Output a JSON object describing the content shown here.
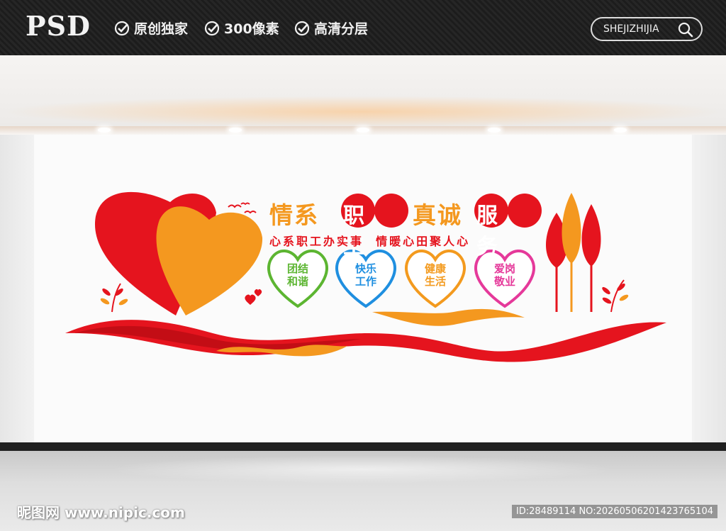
{
  "header": {
    "brand": "PSD",
    "features": [
      "原创独家",
      "300像素",
      "高清分层"
    ],
    "search_label": "SHEJIZHIJIA"
  },
  "artwork": {
    "title_part1": "情系",
    "title_part1_circled": "职工",
    "title_part2": "真诚",
    "title_part2_circled": "服务",
    "subtitle": "心系职工办实事  情暖心田聚人心",
    "hearts": [
      {
        "line1": "团结",
        "line2": "和谐",
        "color": "#5cb531"
      },
      {
        "line1": "快乐",
        "line2": "工作",
        "color": "#1f8fe0"
      },
      {
        "line1": "健康",
        "line2": "生活",
        "color": "#f39a1e"
      },
      {
        "line1": "爱岗",
        "line2": "敬业",
        "color": "#e5399a"
      }
    ],
    "colors": {
      "red": "#e5141e",
      "orange": "#f4981f"
    }
  },
  "watermark": {
    "left": "昵图网 www.nipic.com",
    "right": "ID:28489114 NO:20260506201423765104"
  }
}
